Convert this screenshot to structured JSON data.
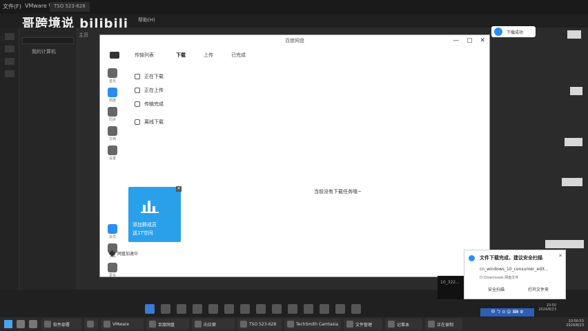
{
  "host": {
    "title": "VMware Workstation",
    "menu": "文件(F)",
    "tab_home": "主页",
    "tab_vm": "TSO 523-628",
    "library_item": "我的计算机",
    "watermark": "哥跨境说 bilibili",
    "menu_help": "帮助(H)"
  },
  "guest": {
    "window_title": "百度网盘",
    "nav_tabs": [
      "传输列表",
      "下载",
      "上传",
      "已完成"
    ],
    "window_buttons": [
      "—",
      "▢",
      "✕"
    ],
    "side": [
      "首页",
      "网盘",
      "同步",
      "文档",
      "设置"
    ],
    "side_bottom": [
      "会员",
      "工具",
      "更多"
    ],
    "menu": [
      "正在下载",
      "正在上传",
      "传输完成",
      "离线下载"
    ],
    "empty_text": "当前没有下载任务哦~",
    "promo_line1": "添加群成员",
    "promo_line2": "送1T空间",
    "bottom_text": "网盘加速中"
  },
  "toast_top": {
    "label": "下载成功"
  },
  "notification": {
    "title": "文件下载完成，建议安全扫描",
    "filename": "cn_windows_10_consumer_edit...",
    "path": "D:\\Downloads  网盘文件",
    "btn_scan": "安全扫描",
    "btn_open": "打开文件夹",
    "close": "✕"
  },
  "patch_text": "10_322...",
  "guest_clock": {
    "time": "10:50",
    "date": "2024/8/23"
  },
  "ime": "中 ㄅ ⊙ ☺ ⌨ ⚙",
  "taskbar": {
    "apps": [
      "软件部署",
      "VMware",
      "百度网盘",
      "向日葵",
      "TSO 523-628",
      "TechSmith Camtasia",
      "文件管理",
      "记事本",
      "正在录制"
    ],
    "clock": "10:50:53",
    "date": "2024/8/23"
  }
}
